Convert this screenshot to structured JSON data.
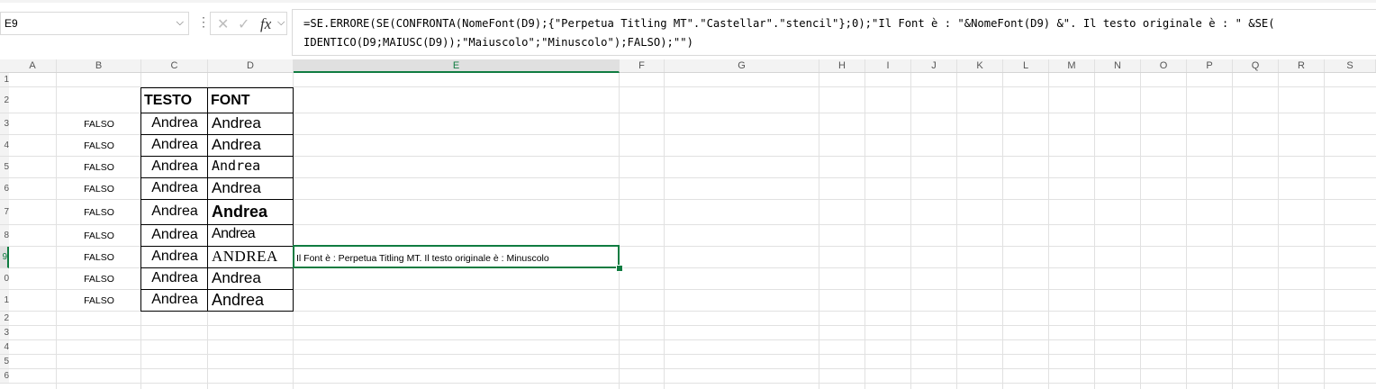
{
  "formula_bar": {
    "name_box": "E9",
    "separator": "⋮",
    "cancel_icon": "✕",
    "enter_icon": "✓",
    "fx_label": "fx",
    "formula_line1": "=SE.ERRORE(SE(CONFRONTA(NomeFont(D9);{\"Perpetua Titling MT\".\"Castellar\".\"stencil\"};0);\"Il Font è : \"&NomeFont(D9) &\". Il testo originale è : \" &SE(",
    "formula_line2": "IDENTICO(D9;MAIUSC(D9));\"Maiuscolo\";\"Minuscolo\");FALSO);\"\")"
  },
  "columns": [
    "A",
    "B",
    "C",
    "D",
    "E",
    "F",
    "G",
    "H",
    "I",
    "J",
    "K",
    "L",
    "M",
    "N",
    "O",
    "P",
    "Q",
    "R",
    "S"
  ],
  "selected_column": "E",
  "rows": [
    "1",
    "2",
    "3",
    "4",
    "5",
    "6",
    "7",
    "8",
    "9",
    "0",
    "1",
    "2",
    "3",
    "4",
    "5",
    "6"
  ],
  "selected_row_index": 8,
  "table_header": {
    "testo": "TESTO",
    "font": "FONT"
  },
  "table_rows": [
    {
      "b": "FALSO",
      "c": "Andrea",
      "d": "Andrea"
    },
    {
      "b": "FALSO",
      "c": "Andrea",
      "d": "Andrea"
    },
    {
      "b": "FALSO",
      "c": "Andrea",
      "d": "Andrea"
    },
    {
      "b": "FALSO",
      "c": "Andrea",
      "d": "Andrea"
    },
    {
      "b": "FALSO",
      "c": "Andrea",
      "d": "Andrea"
    },
    {
      "b": "FALSO",
      "c": "Andrea",
      "d": "Andrea"
    },
    {
      "b": "FALSO",
      "c": "Andrea",
      "d": "ANDREA"
    },
    {
      "b": "FALSO",
      "c": "Andrea",
      "d": "Andrea"
    },
    {
      "b": "FALSO",
      "c": "Andrea",
      "d": "Andrea"
    }
  ],
  "e9_value": "Il Font è : Perpetua Titling MT. Il testo originale è : Minuscolo",
  "colors": {
    "accent": "#107c41",
    "grid": "#e1e1e1",
    "header_bg": "#f3f3f3"
  }
}
